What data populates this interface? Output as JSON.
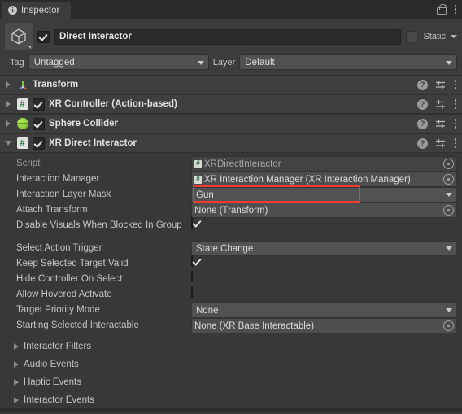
{
  "window": {
    "tab_label": "Inspector",
    "tab_icon": "info-icon",
    "lock_icon": "lock-open-icon",
    "menu_icon": "kebab-menu-icon"
  },
  "gameobject": {
    "icon": "cube-icon",
    "enabled": true,
    "name": "Direct Interactor",
    "static_label": "Static",
    "static_checked": false,
    "tag_label": "Tag",
    "tag_value": "Untagged",
    "layer_label": "Layer",
    "layer_value": "Default"
  },
  "components": [
    {
      "name": "Transform",
      "icon": "transform-gizmo-icon",
      "expanded": false,
      "has_enable_toggle": false,
      "enabled": false
    },
    {
      "name": "XR Controller (Action-based)",
      "icon": "script-icon",
      "expanded": false,
      "has_enable_toggle": true,
      "enabled": true
    },
    {
      "name": "Sphere Collider",
      "icon": "sphere-collider-icon",
      "expanded": false,
      "has_enable_toggle": true,
      "enabled": true
    },
    {
      "name": "XR Direct Interactor",
      "icon": "script-icon",
      "expanded": true,
      "has_enable_toggle": true,
      "enabled": true
    }
  ],
  "component_tools": {
    "help": "?",
    "settings_icon": "settings-sliders-icon",
    "menu_icon": "kebab-menu-icon"
  },
  "properties": {
    "group_one": [
      {
        "label": "Script",
        "type": "object",
        "value": "XRDirectInteractor",
        "readonly": true,
        "has_obj_icon": true
      },
      {
        "label": "Interaction Manager",
        "type": "object",
        "value": "XR Interaction Manager (XR Interaction Manager)",
        "readonly": false,
        "has_obj_icon": true
      },
      {
        "label": "Interaction Layer Mask",
        "type": "select",
        "value": "Gun",
        "highlighted": true
      },
      {
        "label": "Attach Transform",
        "type": "object",
        "value": "None (Transform)",
        "readonly": false,
        "has_obj_icon": false
      },
      {
        "label": "Disable Visuals When Blocked In Group",
        "type": "checkbox",
        "checked": true,
        "clipped": true
      }
    ],
    "group_two": [
      {
        "label": "Select Action Trigger",
        "type": "select",
        "value": "State Change"
      },
      {
        "label": "Keep Selected Target Valid",
        "type": "checkbox",
        "checked": true
      },
      {
        "label": "Hide Controller On Select",
        "type": "checkbox",
        "checked": false
      },
      {
        "label": "Allow Hovered Activate",
        "type": "checkbox",
        "checked": false
      },
      {
        "label": "Target Priority Mode",
        "type": "select",
        "value": "None"
      },
      {
        "label": "Starting Selected Interactable",
        "type": "object",
        "value": "None (XR Base Interactable)",
        "readonly": false,
        "has_obj_icon": false
      }
    ]
  },
  "foldout_sections": [
    {
      "label": "Interactor Filters",
      "expanded": false
    },
    {
      "label": "Audio Events",
      "expanded": false
    },
    {
      "label": "Haptic Events",
      "expanded": false
    },
    {
      "label": "Interactor Events",
      "expanded": false
    }
  ],
  "colors": {
    "panel_bg": "#383838",
    "header_bg": "#3c3c3c",
    "component_header_bg": "#3e3e3e",
    "field_bg": "#4e4e4e",
    "highlight_outline": "#f23b31",
    "text": "#c4c4c4",
    "script_green": "#1f7a33"
  }
}
